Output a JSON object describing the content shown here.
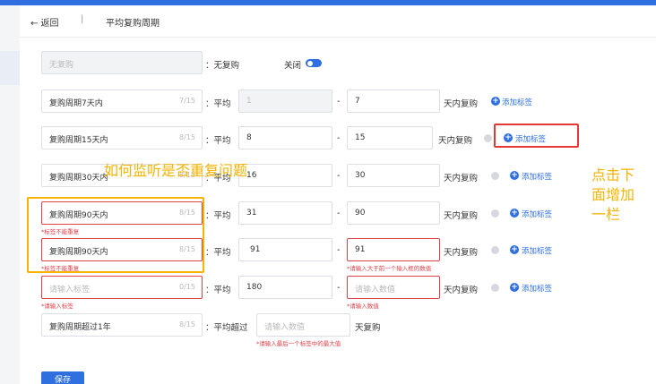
{
  "header": {
    "back_label": "← 返回",
    "separator": "|",
    "title": "平均复购周期"
  },
  "no_repurchase": {
    "value": "无复购",
    "label": "：无复购",
    "toggle_label": "关闭",
    "toggle_on": true
  },
  "rows": [
    {
      "label": "复购周期7天内",
      "count": "7/15",
      "avg": "：平均",
      "min": "1",
      "max": "7",
      "suffix": "天内复购"
    },
    {
      "label": "复购周期15天内",
      "count": "8/15",
      "avg": "：平均",
      "min": "8",
      "max": "15",
      "suffix": "天内复购"
    },
    {
      "label": "复购周期30天内",
      "count": "8/15",
      "avg": "：平均",
      "min": "16",
      "max": "30",
      "suffix": "天内复购"
    },
    {
      "label": "复购周期90天内",
      "count": "8/15",
      "avg": "：平均",
      "min": "31",
      "max": "90",
      "suffix": "天内复购",
      "label_error": "*标签不能重复"
    },
    {
      "label": "复购周期90天内",
      "count": "8/15",
      "avg": "：平均",
      "min": "91",
      "max": "91",
      "suffix": "天内复购",
      "label_error": "*标签不能重复",
      "max_error": "*请输入大于前一个输入框的数值"
    },
    {
      "label_placeholder": "请输入标签",
      "count": "0/15",
      "avg": "：平均",
      "min": "180",
      "max_placeholder": "请输入数值",
      "suffix": "天内复购",
      "label_error": "*请输入标签",
      "max_error": "*请输入数值"
    }
  ],
  "add_tag_label": "添加标签",
  "last_row": {
    "label": "复购周期超过1年",
    "count": "8/15",
    "avg": "：平均超过",
    "placeholder": "请输入数值",
    "suffix": "天复购",
    "error": "*请输入最后一个标签中的最大值"
  },
  "save_label": "保存",
  "annotations": {
    "question": "如何监听是否重复问题",
    "click_note_1": "点击下",
    "click_note_2": "面增加",
    "click_note_3": "一栏"
  },
  "colors": {
    "primary": "#2f6fe0",
    "error": "#e0414b",
    "annotation": "#f6b300",
    "highlight": "#e53935"
  }
}
